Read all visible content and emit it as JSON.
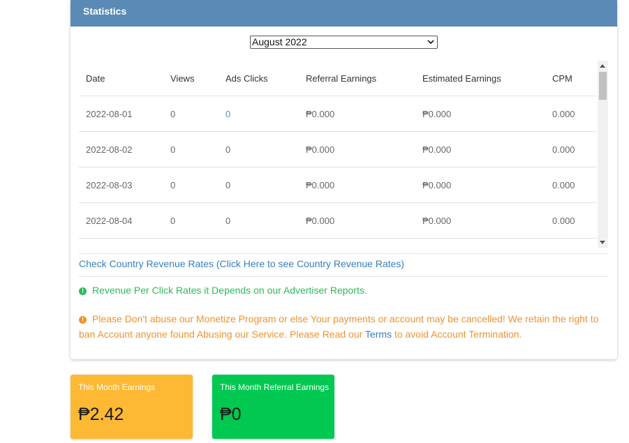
{
  "header": {
    "title": "Statistics"
  },
  "month_select": {
    "selected": "August 2022"
  },
  "table": {
    "columns": [
      "Date",
      "Views",
      "Ads Clicks",
      "Referral Earnings",
      "Estimated Earnings",
      "CPM"
    ],
    "rows": [
      [
        "2022-08-01",
        "0",
        "0",
        "₱0.000",
        "₱0.000",
        "0.000"
      ],
      [
        "2022-08-02",
        "0",
        "0",
        "₱0.000",
        "₱0.000",
        "0.000"
      ],
      [
        "2022-08-03",
        "0",
        "0",
        "₱0.000",
        "₱0.000",
        "0.000"
      ],
      [
        "2022-08-04",
        "0",
        "0",
        "₱0.000",
        "₱0.000",
        "0.000"
      ]
    ]
  },
  "links": {
    "country_rates": "Check Country Revenue Rates (Click Here to see Country Revenue Rates)"
  },
  "notices": {
    "info": "Revenue Per Click Rates it Depends on our Advertiser Reports.",
    "warning_before": "Please Don't abuse our Monetize Program or else Your payments or account may be cancelled! We retain the right to ban Account anyone found Abusing our Service. Please Read our",
    "warning_link": "Terms",
    "warning_after": "to avoid Account Termination."
  },
  "stats": {
    "month_earnings_label": "This Month Earnings",
    "month_earnings_value": "₱2.42",
    "referral_earnings_label": "This Month Referral Earnings",
    "referral_earnings_value": "₱0"
  },
  "colors": {
    "header": "#5a8ab5",
    "link": "#3580c0",
    "info": "#2dba5a",
    "warning": "#f0922b",
    "earnings_box": "#fdb933",
    "referral_box": "#00c851"
  },
  "icons": {
    "month_select": "chevron-down-icon",
    "info": "info-circle-icon",
    "warning": "exclamation-circle-icon",
    "scroll_up": "scroll-up-arrow-icon",
    "scroll_down": "scroll-down-arrow-icon"
  }
}
